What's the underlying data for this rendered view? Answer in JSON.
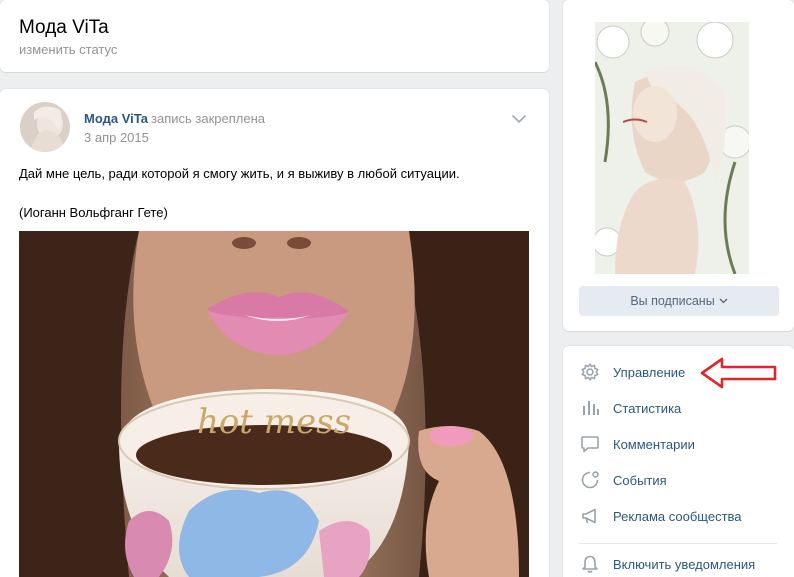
{
  "header": {
    "title": "Мода ViTa",
    "status_link": "изменить статус"
  },
  "post": {
    "author": "Мода ViTa",
    "pinned_label": "запись закреплена",
    "date": "3 апр 2015",
    "text_line_1": "Дай мне цель, ради которой я смогу жить, и я выживу в любой ситуации.",
    "text_line_2": "(Иоганн Вольфганг Гете)",
    "image_cup_text": "hot mess"
  },
  "sidebar": {
    "subscribed_label": "Вы подписаны",
    "menu": [
      {
        "label": "Управление",
        "icon": "gear-icon"
      },
      {
        "label": "Статистика",
        "icon": "stats-icon"
      },
      {
        "label": "Комментарии",
        "icon": "comment-icon"
      },
      {
        "label": "События",
        "icon": "events-icon"
      },
      {
        "label": "Реклама сообщества",
        "icon": "megaphone-icon"
      },
      {
        "label": "Включить уведомления",
        "icon": "bell-icon"
      }
    ]
  },
  "colors": {
    "link": "#2a5885",
    "secondary_text": "#939393",
    "page_bg": "#edeef0",
    "button_bg": "#e5ebf1",
    "annotation_arrow": "#e0262b"
  }
}
